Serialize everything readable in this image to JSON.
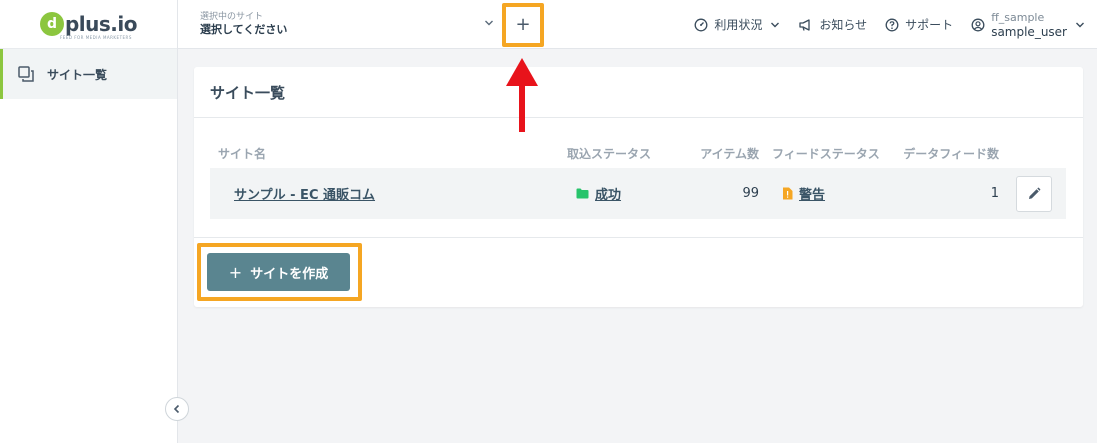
{
  "brand": {
    "logo_letter": "d",
    "logo_text": "plus.io",
    "logo_tagline": "FEED FOR MEDIA MARKETERS"
  },
  "sidebar": {
    "items": [
      {
        "label": "サイト一覧",
        "icon": "copy-pages-icon"
      }
    ]
  },
  "header": {
    "site_select_label": "選択中のサイト",
    "site_select_value": "選択してください",
    "add_site_label": "+",
    "usage_label": "利用状況",
    "news_label": "お知らせ",
    "support_label": "サポート",
    "user_org": "ff_sample",
    "user_name": "sample_user"
  },
  "card": {
    "title": "サイト一覧",
    "columns": [
      "サイト名",
      "取込ステータス",
      "アイテム数",
      "フィードステータス",
      "データフィード数"
    ],
    "rows": [
      {
        "site_name": "サンプル - EC 通販コム",
        "import_status": "成功",
        "items": "99",
        "feed_status": "警告",
        "feed_count": "1"
      }
    ],
    "create_label": "サイトを作成",
    "create_plus": "+"
  },
  "colors": {
    "accent_green": "#8cc63f",
    "status_success": "#27c46b",
    "status_warning": "#f5a623",
    "highlight": "#f5a623",
    "arrow": "#e8131b",
    "button": "#5a8590"
  }
}
